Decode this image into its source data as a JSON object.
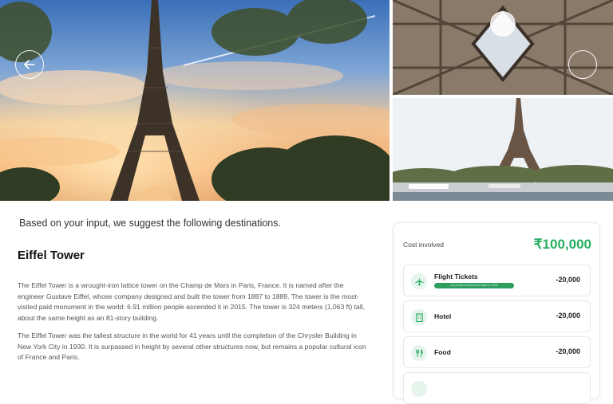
{
  "gallery": {
    "hero_alt": "Eiffel Tower at sunset",
    "prev_icon": "arrow-left-icon",
    "next_icon": "circle-outline-icon"
  },
  "intro_text": "Based on your input, we suggest the following destinations.",
  "destination": {
    "name": "Eiffel Tower",
    "paragraphs": [
      "The Eiffel Tower is a wrought-iron lattice tower on the Champ de Mars in Paris, France. It is named after the engineer Gustave Eiffel, whose company designed and built the tower from 1887 to 1889. The tower is the most-visited paid monument in the world: 6.91 million people ascended it in 2015. The tower is 324 meters (1,063 ft) tall, about the same height as an 81-story building.",
      "The Eiffel Tower was the tallest structure in the world for 41 years until the completion of the Chrysler Building in New York City in 1930. It is surpassed in height by several other structures now, but remains a popular cultural icon of France and Paris."
    ]
  },
  "cost": {
    "label": "Cost involved",
    "total": "₹100,000",
    "items": [
      {
        "label": "Flight Tickets",
        "amount": "-20,000",
        "icon": "airplane-icon",
        "pill": "10 people booked this flight in 1990"
      },
      {
        "label": "Hotel",
        "amount": "-20,000",
        "icon": "hotel-building-icon"
      },
      {
        "label": "Food",
        "amount": "-20,000",
        "icon": "fork-knife-icon"
      },
      {
        "label": "",
        "amount": "",
        "icon": "extra-icon"
      }
    ]
  },
  "colors": {
    "accent_green": "#27ae60",
    "icon_bg": "#e6f4ec"
  }
}
